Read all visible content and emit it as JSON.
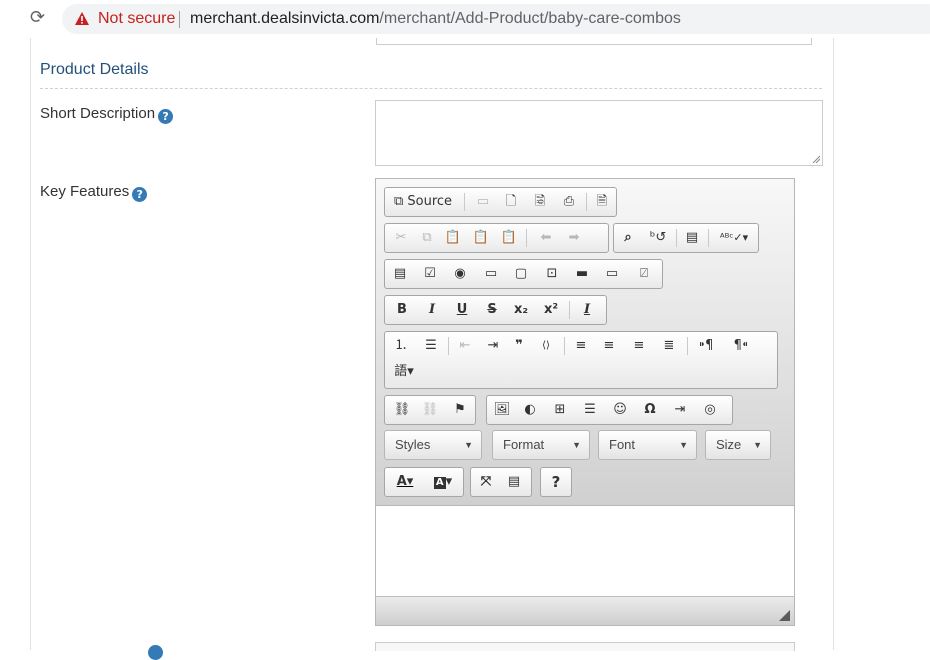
{
  "browser": {
    "reload_icon": "reload-icon",
    "security_label": "Not secure",
    "url_host": "merchant.dealsinvicta.com",
    "url_path": "/merchant/Add-Product/baby-care-combos"
  },
  "section": {
    "title": "Product Details"
  },
  "fields": {
    "short_description_label": "Short Description",
    "key_features_label": "Key Features",
    "help_glyph": "?"
  },
  "editor": {
    "source_label": "Source",
    "bold": "B",
    "italic": "I",
    "underline": "U",
    "strike": "S",
    "help_glyph": "?",
    "combos": {
      "styles": "Styles",
      "format": "Format",
      "font": "Font",
      "size": "Size"
    }
  },
  "colors": {
    "link_blue": "#24507a",
    "help_blue": "#337ab7",
    "warning_red": "#c5221f"
  }
}
